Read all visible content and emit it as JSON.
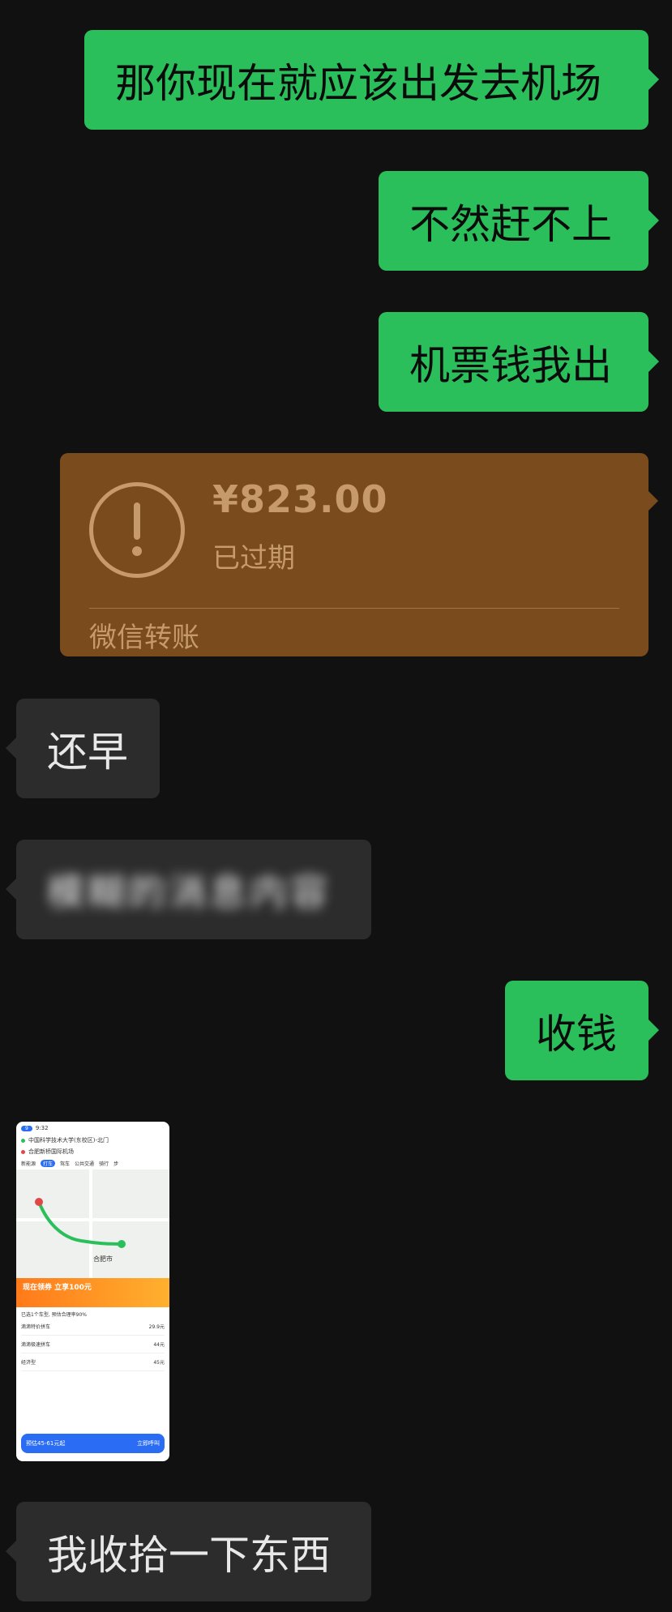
{
  "messages": {
    "m1": "那你现在就应该出发去机场",
    "m2": "不然赶不上",
    "m3": "机票钱我出",
    "m4": "还早",
    "m5": "收钱",
    "m6": "我收拾一下东西"
  },
  "transfer": {
    "amount": "¥823.00",
    "status": "已过期",
    "label": "微信转账"
  },
  "blurred": {
    "text": "模糊的消息内容"
  },
  "screenshot": {
    "origin": "中国科学技术大学(东校区)-北门",
    "destination": "合肥新桥国际机场",
    "tabs": [
      "新能源",
      "打车",
      "驾车",
      "公共交通",
      "骑行",
      "步"
    ],
    "city": "合肥市",
    "banner": "现在领券 立享100元",
    "progress_text": "已选1个车型, 预估合理率90%",
    "items": [
      {
        "name": "滴滴特价拼车",
        "price": "29.9元"
      },
      {
        "name": "滴滴极速拼车",
        "price": "44元"
      },
      {
        "name": "经济型",
        "price": "45元"
      }
    ],
    "footer_price": "预估45-61元起",
    "footer_button": "立即呼叫"
  }
}
